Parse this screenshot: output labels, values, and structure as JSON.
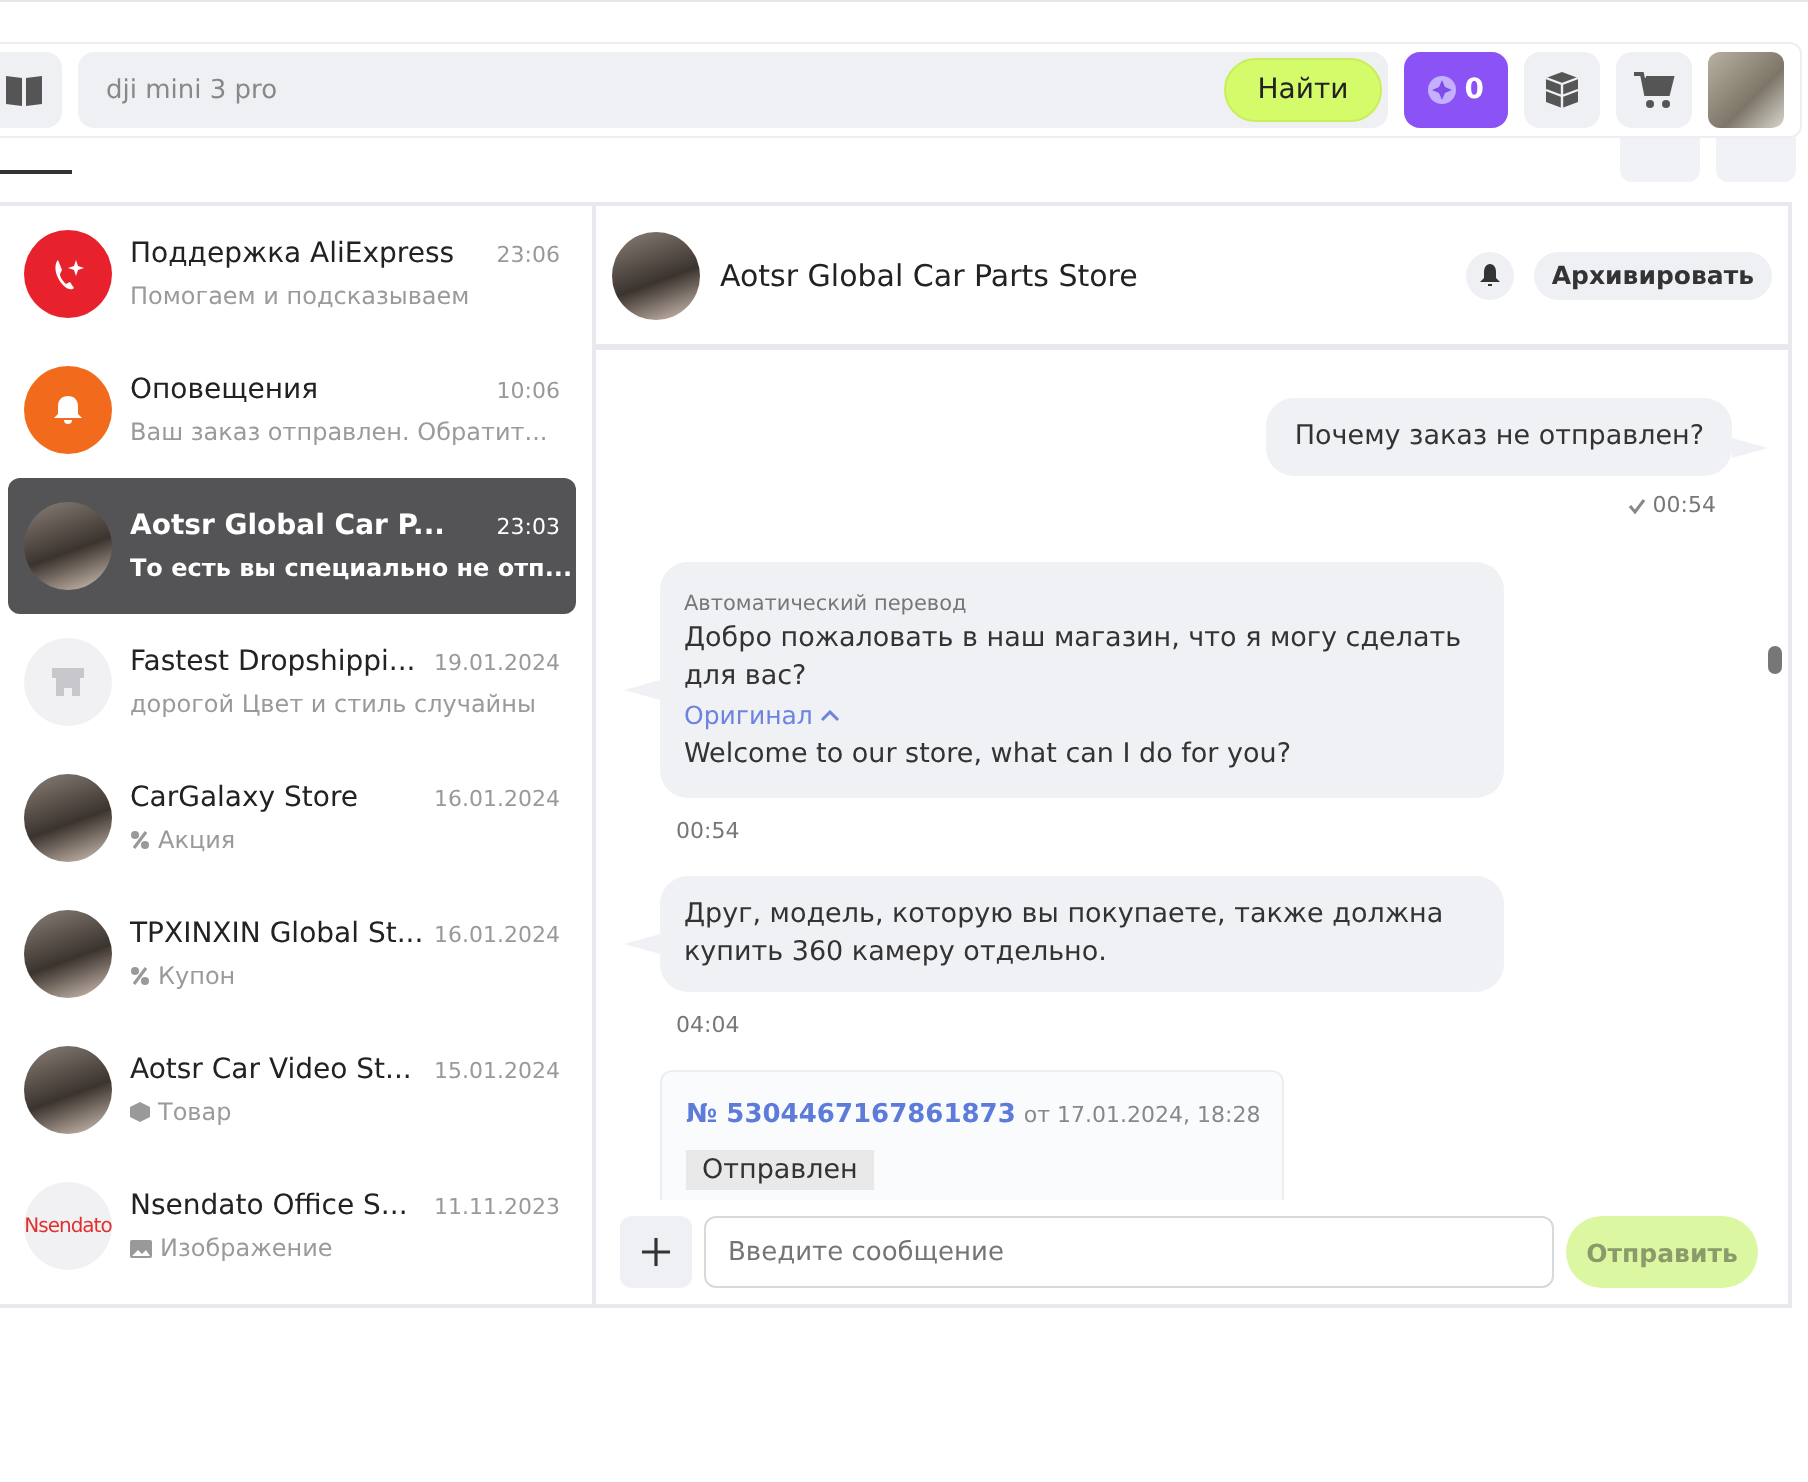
{
  "search": {
    "value": "dji mini 3 pro",
    "button": "Найти"
  },
  "coins": {
    "count": "0"
  },
  "chats": [
    {
      "name": "Поддержка AliExpress",
      "time": "23:06",
      "preview": "Помогаем и подсказываем",
      "avatar": {
        "kind": "support"
      },
      "selected": false
    },
    {
      "name": "Оповещения",
      "time": "10:06",
      "preview": "Ваш заказ отправлен. Обратит...",
      "avatar": {
        "kind": "bell"
      },
      "selected": false
    },
    {
      "name": "Aotsr Global Car P...",
      "time": "23:03",
      "preview": "То есть вы специально не отп...",
      "avatar": {
        "kind": "photo"
      },
      "selected": true
    },
    {
      "name": "Fastest Dropshippi...",
      "time": "19.01.2024",
      "preview": "дорогой Цвет и стиль случайны",
      "avatar": {
        "kind": "store"
      },
      "selected": false
    },
    {
      "name": "CarGalaxy Store",
      "time": "16.01.2024",
      "preview": "Акция",
      "avatar": {
        "kind": "photo"
      },
      "preview_icon": {
        "kind": "percent"
      },
      "selected": false
    },
    {
      "name": "TPXINXIN Global St...",
      "time": "16.01.2024",
      "preview": "Купон",
      "avatar": {
        "kind": "photo"
      },
      "preview_icon": {
        "kind": "percent"
      },
      "selected": false
    },
    {
      "name": "Aotsr Car Video St...",
      "time": "15.01.2024",
      "preview": "Товар",
      "avatar": {
        "kind": "photo"
      },
      "preview_icon": {
        "kind": "box"
      },
      "selected": false
    },
    {
      "name": "Nsendato Office S...",
      "time": "11.11.2023",
      "preview": "Изображение",
      "avatar": {
        "kind": "logo",
        "text": "Nsendato"
      },
      "preview_icon": {
        "kind": "image"
      },
      "selected": false
    }
  ],
  "chat_header": {
    "title": "Aotsr Global Car Parts Store",
    "archive": "Архивировать"
  },
  "messages": [
    {
      "kind": "outgoing",
      "text": "Почему заказ не отправлен?",
      "time": "00:54",
      "read": true
    },
    {
      "kind": "translated",
      "label": "Автоматический перевод",
      "text": "Добро пожаловать в наш магазин, что я могу сделать для вас?",
      "original_toggle": "Оригинал",
      "original_expanded": true,
      "original": "Welcome to our store, what can I do for you?",
      "time": "00:54"
    },
    {
      "kind": "incoming",
      "text": "Друг, модель, которую вы покупаете, также должна купить 360 камеру отдельно.",
      "time": "04:04"
    },
    {
      "kind": "order",
      "number": "№ 5304467167861873",
      "date": "от 17.01.2024, 18:28",
      "status": "Отправлен"
    }
  ],
  "composer": {
    "placeholder": "Введите сообщение",
    "send": "Отправить"
  }
}
